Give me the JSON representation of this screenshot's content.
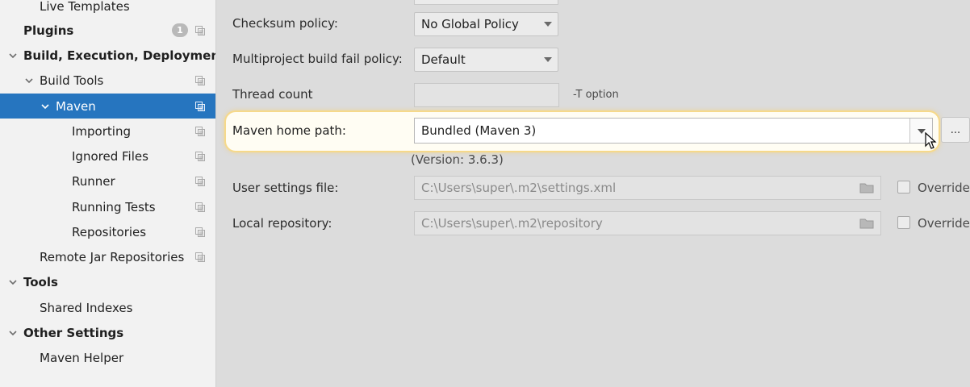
{
  "sidebar": {
    "items": [
      {
        "label": "Live Templates",
        "bold": false,
        "chevron": "none",
        "copy": false
      },
      {
        "label": "Plugins",
        "bold": true,
        "chevron": "none",
        "copy": true,
        "badge": "1"
      },
      {
        "label": "Build, Execution, Deployment",
        "bold": true,
        "chevron": "down",
        "copy": false
      },
      {
        "label": "Build Tools",
        "bold": false,
        "chevron": "down",
        "copy": true
      },
      {
        "label": "Maven",
        "bold": false,
        "chevron": "down",
        "copy": true,
        "selected": true
      },
      {
        "label": "Importing",
        "bold": false,
        "chevron": "none",
        "copy": true
      },
      {
        "label": "Ignored Files",
        "bold": false,
        "chevron": "none",
        "copy": true
      },
      {
        "label": "Runner",
        "bold": false,
        "chevron": "none",
        "copy": true
      },
      {
        "label": "Running Tests",
        "bold": false,
        "chevron": "none",
        "copy": true
      },
      {
        "label": "Repositories",
        "bold": false,
        "chevron": "none",
        "copy": true
      },
      {
        "label": "Remote Jar Repositories",
        "bold": false,
        "chevron": "none",
        "copy": true
      },
      {
        "label": "Tools",
        "bold": true,
        "chevron": "down",
        "copy": false
      },
      {
        "label": "Shared Indexes",
        "bold": false,
        "chevron": "none",
        "copy": false
      },
      {
        "label": "Other Settings",
        "bold": true,
        "chevron": "down",
        "copy": false
      },
      {
        "label": "Maven Helper",
        "bold": false,
        "chevron": "none",
        "copy": false
      }
    ]
  },
  "form": {
    "checksum_label": "Checksum policy:",
    "checksum_value": "No Global Policy",
    "failpolicy_label": "Multiproject build fail policy:",
    "failpolicy_value": "Default",
    "thread_label": "Thread count",
    "thread_value": "",
    "thread_hint": "-T option",
    "home_label": "Maven home path:",
    "home_value": "Bundled (Maven 3)",
    "browse_label": "...",
    "version_text": "(Version: 3.6.3)",
    "settings_label": "User settings file:",
    "settings_value": "C:\\Users\\super\\.m2\\settings.xml",
    "settings_override": "Override",
    "repo_label": "Local repository:",
    "repo_value": "C:\\Users\\super\\.m2\\repository",
    "repo_override": "Override"
  },
  "colors": {
    "selection": "#2675bf",
    "highlight_border": "#f6d98a"
  }
}
